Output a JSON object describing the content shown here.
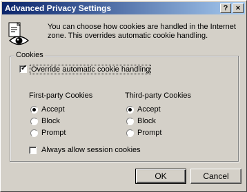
{
  "window": {
    "title": "Advanced Privacy Settings",
    "help_glyph": "?",
    "close_glyph": "×"
  },
  "info": {
    "text": "You can choose how cookies are handled in the Internet zone.  This overrides automatic cookie handling."
  },
  "cookies": {
    "group_label": "Cookies",
    "override_label": "Override automatic cookie handling",
    "override_checked": true,
    "first_party": {
      "heading": "First-party Cookies",
      "options": [
        "Accept",
        "Block",
        "Prompt"
      ],
      "selected": "Accept"
    },
    "third_party": {
      "heading": "Third-party Cookies",
      "options": [
        "Accept",
        "Block",
        "Prompt"
      ],
      "selected": "Accept"
    },
    "session_label": "Always allow session cookies",
    "session_checked": false
  },
  "buttons": {
    "ok": "OK",
    "cancel": "Cancel"
  }
}
